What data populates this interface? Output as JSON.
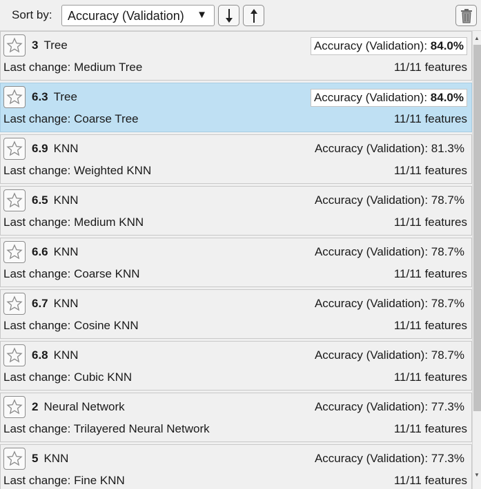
{
  "toolbar": {
    "sort_label": "Sort by:",
    "sort_value": "Accuracy (Validation)",
    "sort_down_icon": "arrow-down-icon",
    "sort_up_icon": "arrow-up-icon",
    "delete_icon": "trash-icon"
  },
  "models": [
    {
      "id": "3",
      "type": "Tree",
      "metric_label": "Accuracy (Validation):",
      "metric_value": "84.0%",
      "last_change_label": "Last change:",
      "last_change": "Medium Tree",
      "features": "11/11 features"
    },
    {
      "id": "6.3",
      "type": "Tree",
      "metric_label": "Accuracy (Validation):",
      "metric_value": "84.0%",
      "last_change_label": "Last change:",
      "last_change": "Coarse Tree",
      "features": "11/11 features"
    },
    {
      "id": "6.9",
      "type": "KNN",
      "metric_label": "Accuracy (Validation):",
      "metric_value": "81.3%",
      "last_change_label": "Last change:",
      "last_change": "Weighted KNN",
      "features": "11/11 features"
    },
    {
      "id": "6.5",
      "type": "KNN",
      "metric_label": "Accuracy (Validation):",
      "metric_value": "78.7%",
      "last_change_label": "Last change:",
      "last_change": "Medium KNN",
      "features": "11/11 features"
    },
    {
      "id": "6.6",
      "type": "KNN",
      "metric_label": "Accuracy (Validation):",
      "metric_value": "78.7%",
      "last_change_label": "Last change:",
      "last_change": "Coarse KNN",
      "features": "11/11 features"
    },
    {
      "id": "6.7",
      "type": "KNN",
      "metric_label": "Accuracy (Validation):",
      "metric_value": "78.7%",
      "last_change_label": "Last change:",
      "last_change": "Cosine KNN",
      "features": "11/11 features"
    },
    {
      "id": "6.8",
      "type": "KNN",
      "metric_label": "Accuracy (Validation):",
      "metric_value": "78.7%",
      "last_change_label": "Last change:",
      "last_change": "Cubic KNN",
      "features": "11/11 features"
    },
    {
      "id": "2",
      "type": "Neural Network",
      "metric_label": "Accuracy (Validation):",
      "metric_value": "77.3%",
      "last_change_label": "Last change:",
      "last_change": "Trilayered Neural Network",
      "features": "11/11 features"
    },
    {
      "id": "5",
      "type": "KNN",
      "metric_label": "Accuracy (Validation):",
      "metric_value": "77.3%",
      "last_change_label": "Last change:",
      "last_change": "Fine KNN",
      "features": "11/11 features"
    }
  ],
  "selected_model_id": "6.3",
  "best_model_ids": [
    "3",
    "6.3"
  ],
  "colors": {
    "selected_row": "#bfe0f3",
    "background": "#f0f0f0"
  }
}
